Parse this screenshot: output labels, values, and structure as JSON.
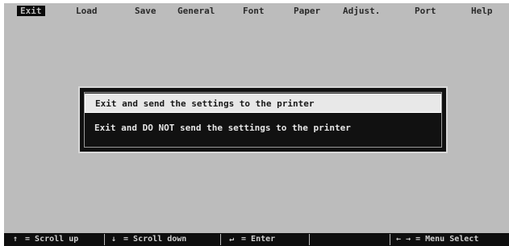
{
  "menubar": {
    "items": [
      {
        "label": "Exit",
        "active": true
      },
      {
        "label": "Load"
      },
      {
        "label": "Save"
      },
      {
        "label": "General"
      },
      {
        "label": "Font"
      },
      {
        "label": "Paper"
      },
      {
        "label": "Adjust."
      },
      {
        "label": "Port"
      },
      {
        "label": "Help"
      }
    ]
  },
  "dialog": {
    "options": [
      {
        "label": "Exit and send the settings to the printer",
        "selected": true
      },
      {
        "label": "Exit and DO NOT send the settings to the printer",
        "selected": false
      }
    ]
  },
  "statusbar": {
    "scroll_up": {
      "glyph": "↑",
      "text": " = Scroll up"
    },
    "scroll_down": {
      "glyph": "↓",
      "text": " = Scroll down"
    },
    "enter": {
      "glyph": "↵",
      "text": " = Enter"
    },
    "menu_select": {
      "glyph": "← →",
      "text": " = Menu Select"
    }
  },
  "colors": {
    "screen_bg": "#bcbcbc",
    "dialog_bg": "#111111",
    "selected_bg": "#e8e8e8",
    "statusbar_bg": "#0e0e0e"
  }
}
